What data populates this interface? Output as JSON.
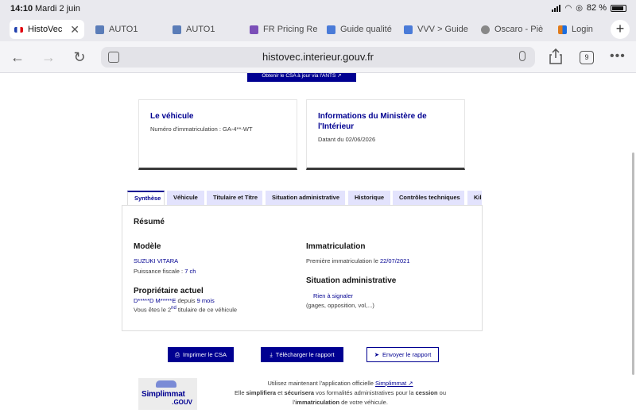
{
  "status_bar": {
    "time": "14:10",
    "date": "Mardi 2 juin",
    "battery": "82 %"
  },
  "browser": {
    "tabs": [
      {
        "label": "HistoVec",
        "active": true,
        "favicon_color": "#3b5bdb"
      },
      {
        "label": "AUTO1",
        "active": false,
        "favicon_color": "#5b7db8"
      },
      {
        "label": "AUTO1",
        "active": false,
        "favicon_color": "#5b7db8"
      },
      {
        "label": "FR Pricing Re",
        "active": false,
        "favicon_color": "#7b4fb8"
      },
      {
        "label": "Guide qualité",
        "active": false,
        "favicon_color": "#4a7bd8"
      },
      {
        "label": "VVV > Guide",
        "active": false,
        "favicon_color": "#4a7bd8"
      },
      {
        "label": "Oscaro - Piè",
        "active": false,
        "favicon_color": "#888888"
      },
      {
        "label": "Login",
        "active": false,
        "favicon_color": "#e07b1b"
      }
    ],
    "url": "histovec.interieur.gouv.fr",
    "tab_count": "9"
  },
  "page": {
    "top_button": "Obtenir le CSA à jour via l'ANTS ↗",
    "vehicle_card": {
      "title": "Le véhicule",
      "line": "Numéro d'immatriculation : GA-4**-WT"
    },
    "ministry_card": {
      "title_line1": "Informations du Ministère de",
      "title_line2": "l'Intérieur",
      "line": "Datant du 02/06/2026"
    },
    "tabs": [
      "Synthèse",
      "Véhicule",
      "Titulaire et Titre",
      "Situation administrative",
      "Historique",
      "Contrôles techniques",
      "Kilo"
    ],
    "summary": {
      "title": "Résumé",
      "model_heading": "Modèle",
      "model_value": "SUZUKI VITARA",
      "power_label": "Puissance fiscale : ",
      "power_value": "7 ch",
      "owner_heading": "Propriétaire actuel",
      "owner_name": "D*****D M*****E",
      "owner_since_label": " depuis ",
      "owner_since_value": "9 mois",
      "owner_rank_prefix": "Vous êtes le 2",
      "owner_rank_sup": "nd",
      "owner_rank_suffix": " titulaire de ce véhicule",
      "immat_heading": "Immatriculation",
      "immat_label": "Première immatriculation le ",
      "immat_date": "22/07/2021",
      "admin_heading": "Situation administrative",
      "admin_value": "Rien à signaler",
      "admin_detail": "(gages, opposition, vol,...)"
    },
    "actions": {
      "print": "Imprimer le CSA",
      "download": "Télécharger le rapport",
      "send": "Envoyer le rapport"
    },
    "simplimmat": {
      "logo_brand": "Simplimmat",
      "logo_gov": ".GOUV",
      "line1_prefix": "Utilisez maintenant l'application officielle ",
      "line1_link": "Simplimmat ↗",
      "line2_a": "Elle ",
      "line2_b": "simplifiera",
      "line2_c": " et ",
      "line2_d": "sécurisera",
      "line2_e": " vos formalités administratives pour la ",
      "line2_f": "cession",
      "line2_g": " ou",
      "line3_a": "l'",
      "line3_b": "immatriculation",
      "line3_c": " de votre véhicule."
    }
  }
}
